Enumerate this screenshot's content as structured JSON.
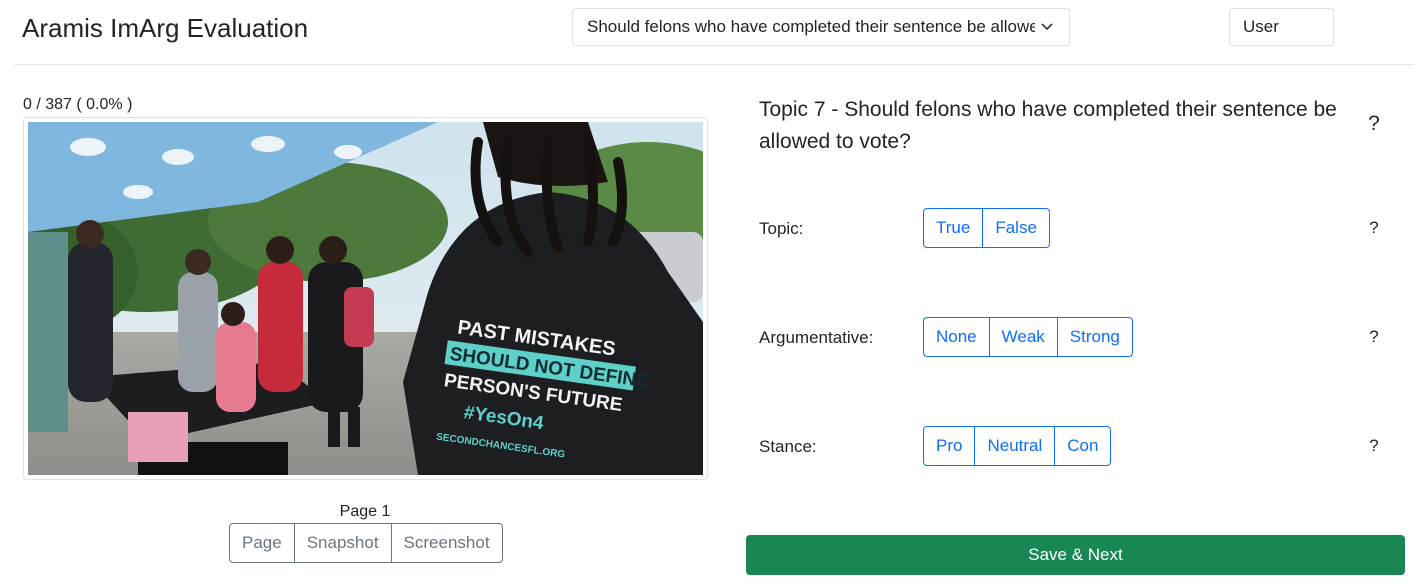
{
  "header": {
    "app_title": "Aramis ImArg Evaluation",
    "topic_select_value": "Should felons who have completed their sentence be allowed to vote?",
    "user_label": "User"
  },
  "left": {
    "progress": "0 / 387 ( 0.0% )",
    "image": {
      "shirt_text_line1": "PAST MISTAKES",
      "shirt_text_line2": "SHOULD NOT DEFINE",
      "shirt_text_line3": "PERSON'S FUTURE",
      "shirt_text_line4": "#YesOn4",
      "shirt_text_line5": "SECONDCHANCESFL.ORG"
    },
    "page_label": "Page 1",
    "view_buttons": [
      "Page",
      "Snapshot",
      "Screenshot"
    ]
  },
  "right": {
    "topic_heading": "Topic 7 - Should felons who have completed their sentence be allowed to vote?",
    "help_glyph": "?",
    "questions": [
      {
        "label": "Topic:",
        "options": [
          "True",
          "False"
        ]
      },
      {
        "label": "Argumentative:",
        "options": [
          "None",
          "Weak",
          "Strong"
        ]
      },
      {
        "label": "Stance:",
        "options": [
          "Pro",
          "Neutral",
          "Con"
        ]
      }
    ],
    "save_label": "Save & Next"
  },
  "colors": {
    "primary": "#0d6efd",
    "secondary": "#6c757d",
    "success": "#198754"
  }
}
